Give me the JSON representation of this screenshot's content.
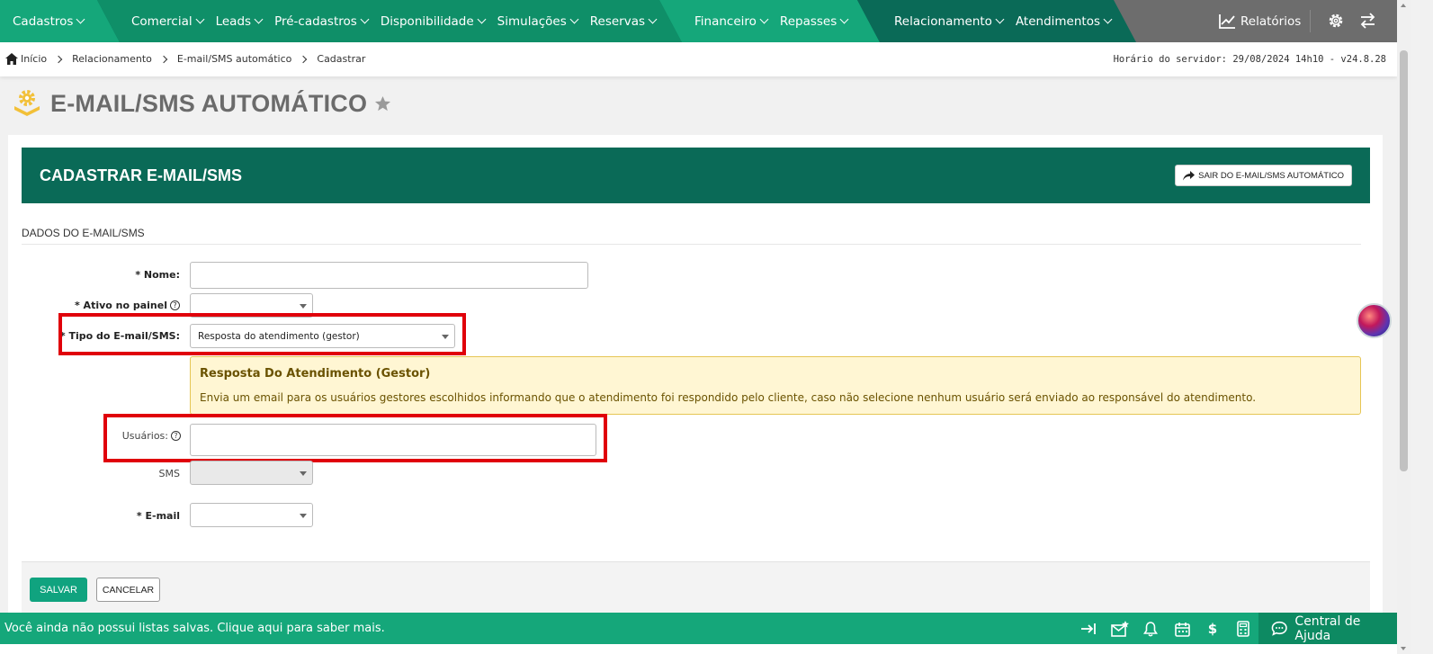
{
  "topnav": {
    "cadastros": "Cadastros",
    "group1": [
      "Comercial",
      "Leads",
      "Pré-cadastros",
      "Disponibilidade",
      "Simulações",
      "Reservas"
    ],
    "group2": [
      "Financeiro",
      "Repasses"
    ],
    "group3": [
      "Relacionamento",
      "Atendimentos"
    ],
    "relatorios": "Relatórios",
    "icons": [
      "chart-line-icon",
      "gear-icon",
      "swap-arrows-icon"
    ],
    "colors": {
      "dark": "#0a6a57",
      "mid": "#0f8f68",
      "light": "#15a77a",
      "gray": "#6b6b6b"
    }
  },
  "breadcrumb": {
    "items": [
      "Início",
      "Relacionamento",
      "E-mail/SMS automático",
      "Cadastrar"
    ],
    "server_time": "Horário do servidor: 29/08/2024 14h10 - v24.8.28"
  },
  "page": {
    "title": "E-MAIL/SMS AUTOMÁTICO"
  },
  "card": {
    "title": "CADASTRAR E-MAIL/SMS",
    "exit_button": "SAIR DO E-MAIL/SMS AUTOMÁTICO",
    "section": "DADOS DO E-MAIL/SMS"
  },
  "form": {
    "nome_label": "* Nome:",
    "nome_value": "",
    "ativo_label": "* Ativo no painel",
    "ativo_value": "",
    "tipo_label": "* Tipo do E-mail/SMS:",
    "tipo_value": "Resposta do atendimento (gestor)",
    "info_title": "Resposta Do Atendimento (Gestor)",
    "info_text": "Envia um email para os usuários gestores escolhidos informando que o atendimento foi respondido pelo cliente, caso não selecione nenhum usuário será enviado ao responsável do atendimento.",
    "usuarios_label": "Usuários:",
    "usuarios_value": "",
    "sms_label": "SMS",
    "sms_value": "",
    "email_label": "* E-mail",
    "email_value": ""
  },
  "actions": {
    "save": "SALVAR",
    "cancel": "CANCELAR"
  },
  "bottombar": {
    "message": "Você ainda não possui listas salvas. Clique aqui para saber mais.",
    "help_center": "Central de Ajuda",
    "icons": [
      "arrow-to-right-icon",
      "mail-star-icon",
      "bell-icon",
      "calendar-icon",
      "dollar-icon",
      "calculator-icon",
      "chat-icon"
    ]
  }
}
